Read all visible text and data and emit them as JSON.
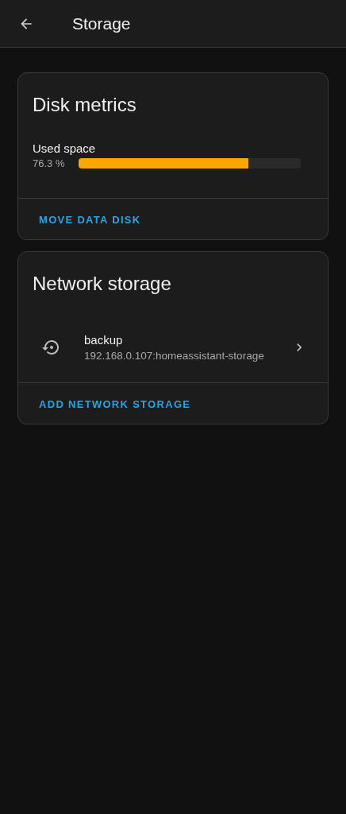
{
  "header": {
    "title": "Storage"
  },
  "disk_metrics": {
    "title": "Disk metrics",
    "label": "Used space",
    "reading": "76.3 %",
    "level": 0.763,
    "action": "MOVE DATA DISK"
  },
  "network_storage": {
    "title": "Network storage",
    "items": [
      {
        "name": "backup",
        "address": "192.168.0.107:homeassistant-storage"
      }
    ],
    "action": "ADD NETWORK STORAGE"
  }
}
